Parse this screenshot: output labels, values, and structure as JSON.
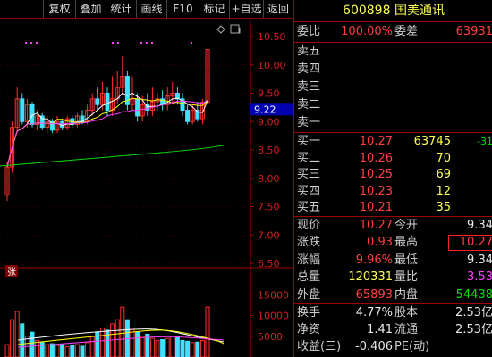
{
  "toolbar": {
    "buttons": [
      "复权",
      "叠加",
      "统计",
      "画线",
      "F10",
      "标记",
      "+自选",
      "返回"
    ]
  },
  "chart": {
    "price_ticks": [
      "10.50",
      "10.00",
      "9.50",
      "9.00",
      "8.50",
      "8.00",
      "7.50",
      "7.00",
      "6.50"
    ],
    "current_price_tag": "9.22",
    "zhang_mark": "张",
    "volume_ticks": [
      "15000",
      "10000",
      "5000"
    ]
  },
  "colors": {
    "up": "#ff3030",
    "down": "#40e0ff",
    "ma5": "#ffffff",
    "ma10": "#ffff00",
    "ma20": "#ff40ff",
    "ma60": "#00dd00",
    "border": "#a00000"
  },
  "quote": {
    "code": "600898",
    "name": "国美通讯",
    "weibi_label": "委比",
    "weibi_value": "100.00%",
    "weicha_label": "委差",
    "weicha_value": "63931",
    "asks": [
      {
        "label": "卖五",
        "price": "",
        "vol": ""
      },
      {
        "label": "卖四",
        "price": "",
        "vol": ""
      },
      {
        "label": "卖三",
        "price": "",
        "vol": ""
      },
      {
        "label": "卖二",
        "price": "",
        "vol": ""
      },
      {
        "label": "卖一",
        "price": "",
        "vol": ""
      }
    ],
    "bids": [
      {
        "label": "买一",
        "price": "10.27",
        "vol": "63745",
        "chg": "-31"
      },
      {
        "label": "买二",
        "price": "10.26",
        "vol": "70",
        "chg": ""
      },
      {
        "label": "买三",
        "price": "10.25",
        "vol": "69",
        "chg": ""
      },
      {
        "label": "买四",
        "price": "10.23",
        "vol": "12",
        "chg": ""
      },
      {
        "label": "买五",
        "price": "10.21",
        "vol": "35",
        "chg": ""
      }
    ],
    "stats": [
      {
        "l1": "现价",
        "v1": "10.27",
        "l2": "今开",
        "v2": "9.34"
      },
      {
        "l1": "涨跌",
        "v1": "0.93",
        "l2": "最高",
        "v2": "10.27"
      },
      {
        "l1": "涨幅",
        "v1": "9.96%",
        "l2": "最低",
        "v2": "9.34"
      },
      {
        "l1": "总量",
        "v1": "120331",
        "l2": "量比",
        "v2": "3.53"
      },
      {
        "l1": "外盘",
        "v1": "65893",
        "l2": "内盘",
        "v2": "54438"
      }
    ],
    "extra": [
      {
        "l1": "换手",
        "v1": "4.77%",
        "l2": "股本",
        "v2": "2.53亿"
      },
      {
        "l1": "净资",
        "v1": "1.41",
        "l2": "流通",
        "v2": "2.53亿"
      },
      {
        "l1": "收益(三)",
        "v1": "-0.406",
        "l2": "PE(动)",
        "v2": ""
      }
    ]
  }
}
